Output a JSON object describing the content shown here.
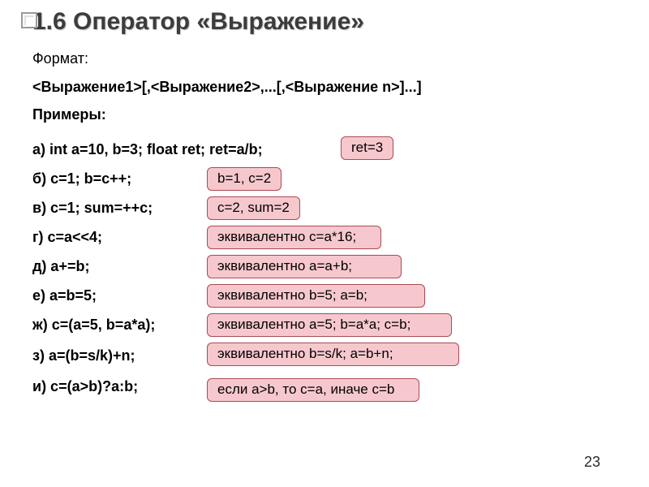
{
  "title": "1.6 Оператор «Выражение»",
  "format_label": "Формат:",
  "syntax": "<Выражение1>[,<Выражение2>,...[,<Выражение n>]...]",
  "examples_label": "Примеры:",
  "items": {
    "a": {
      "text": "а) int  a=10, b=3; float ret; ret=a/b;",
      "ans": "ret=3"
    },
    "b": {
      "text": "б) c=1;   b=c++;",
      "ans": "b=1,  c=2"
    },
    "v": {
      "text": "в) c=1;    sum=++c;",
      "ans": "c=2, sum=2"
    },
    "g": {
      "text": "г) c=a<<4;",
      "ans": "эквивалентно c=a*16;"
    },
    "d": {
      "text": "д) a+=b;",
      "ans": "эквивалентно a=a+b;"
    },
    "e": {
      "text": "е) a=b=5;",
      "ans": "эквивалентно b=5; a=b;"
    },
    "zh": {
      "text": "ж) c=(a=5, b=a*a);",
      "ans": "эквивалентно a=5; b=a*a; c=b;"
    },
    "z": {
      "text": "з) a=(b=s/k)+n;",
      "ans": "эквивалентно b=s/k; a=b+n;"
    },
    "i": {
      "text": "и) c=(a>b)?a:b;",
      "ans": "если a>b, то c=a, иначе c=b"
    }
  },
  "page_number": "23"
}
